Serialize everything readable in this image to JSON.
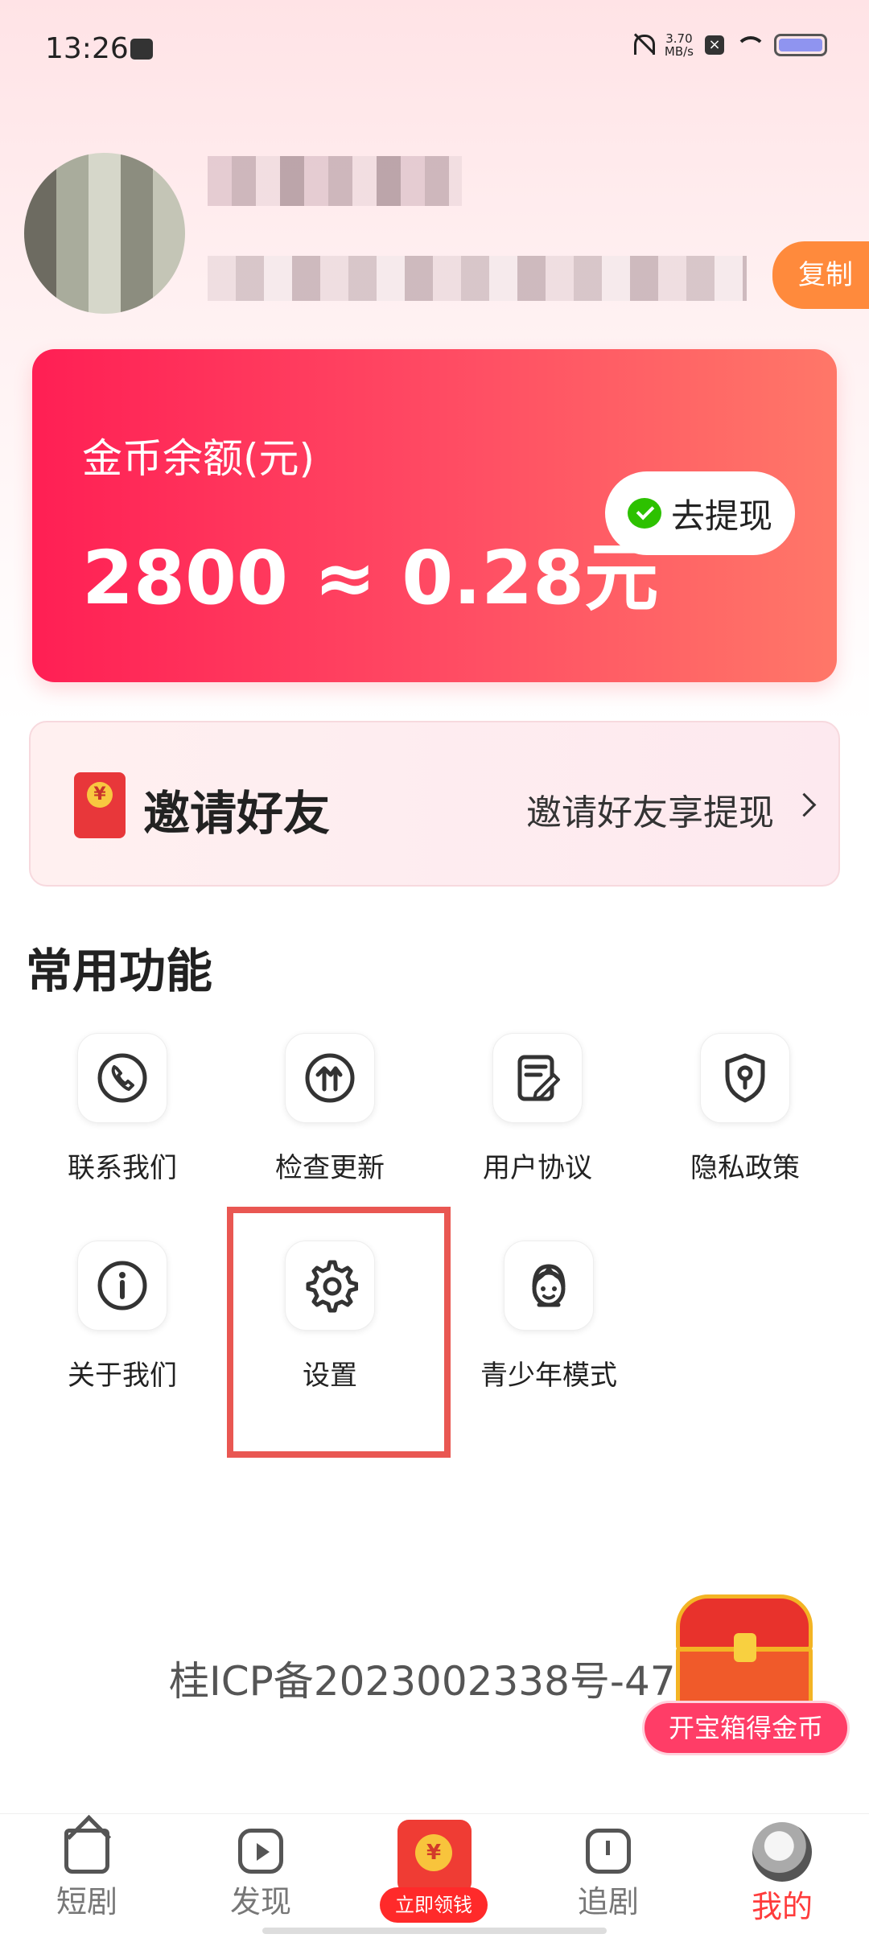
{
  "status_bar": {
    "time": "13:26",
    "speed": "3.70\nMB/s"
  },
  "profile": {
    "copy_label": "复制"
  },
  "coin_card": {
    "label": "金币余额(元)",
    "value": "2800 ≈ 0.28元",
    "withdraw_label": "去提现"
  },
  "invite": {
    "title": "邀请好友",
    "subtitle": "邀请好友享提现"
  },
  "section_title": "常用功能",
  "functions": [
    {
      "label": "联系我们",
      "icon": "phone-icon"
    },
    {
      "label": "检查更新",
      "icon": "update-icon"
    },
    {
      "label": "用户协议",
      "icon": "document-icon"
    },
    {
      "label": "隐私政策",
      "icon": "shield-icon"
    },
    {
      "label": "关于我们",
      "icon": "info-icon"
    },
    {
      "label": "设置",
      "icon": "gear-icon"
    },
    {
      "label": "青少年模式",
      "icon": "child-face-icon"
    }
  ],
  "footer": {
    "icp": "桂ICP备2023002338号-47"
  },
  "floating": {
    "chest_label": "开宝箱得金币"
  },
  "bottom_nav": [
    {
      "label": "短剧",
      "icon": "home-icon"
    },
    {
      "label": "发现",
      "icon": "play-icon"
    },
    {
      "label": "立即领钱",
      "icon": "red-envelope-icon"
    },
    {
      "label": "追剧",
      "icon": "clock-icon"
    },
    {
      "label": "我的",
      "icon": "avatar-icon"
    }
  ],
  "colors": {
    "accent": "#ff3b3b",
    "card_start": "#ff1f54",
    "card_end": "#ff7768",
    "highlight": "#e95752"
  }
}
